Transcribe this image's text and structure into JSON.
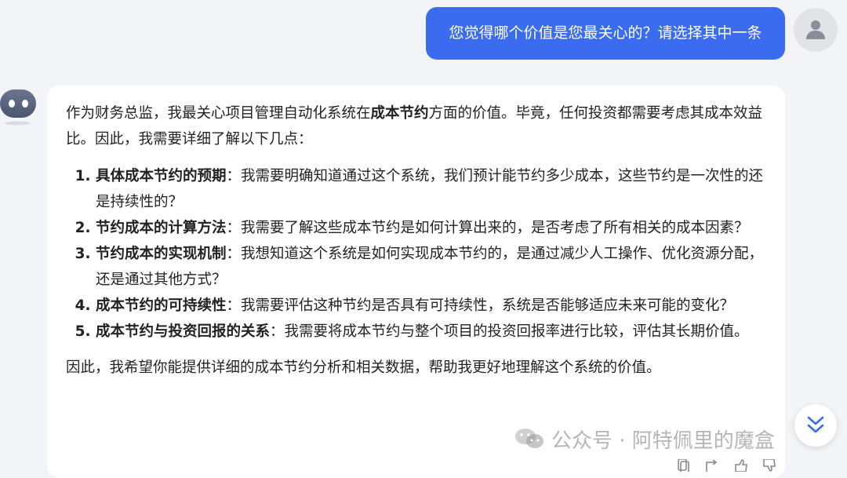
{
  "user_message": "您觉得哪个价值是您最关心的？请选择其中一条",
  "bot_reply": {
    "intro_pre": "作为财务总监，我最关心项目管理自动化系统在",
    "intro_bold": "成本节约",
    "intro_post": "方面的价值。毕竟，任何投资都需要考虑其成本效益比。因此，我需要详细了解以下几点：",
    "points": [
      {
        "title": "具体成本节约的预期",
        "text": "：我需要明确知道通过这个系统，我们预计能节约多少成本，这些节约是一次性的还是持续性的？"
      },
      {
        "title": "节约成本的计算方法",
        "text": "：我需要了解这些成本节约是如何计算出来的，是否考虑了所有相关的成本因素？"
      },
      {
        "title": "节约成本的实现机制",
        "text": "：我想知道这个系统是如何实现成本节约的，是通过减少人工操作、优化资源分配，还是通过其他方式？"
      },
      {
        "title": "成本节约的可持续性",
        "text": "：我需要评估这种节约是否具有可持续性，系统是否能够适应未来可能的变化？"
      },
      {
        "title": "成本节约与投资回报的关系",
        "text": "：我需要将成本节约与整个项目的投资回报率进行比较，评估其长期价值。"
      }
    ],
    "outro": "因此，我希望你能提供详细的成本节约分析和相关数据，帮助我更好地理解这个系统的价值。"
  },
  "watermark": "公众号 · 阿特佩里的魔盒",
  "icons": {
    "user_avatar": "user-icon",
    "bot_avatar": "bot-icon",
    "scroll": "double-chevron-down-icon",
    "watermark_logo": "wechat-icon"
  },
  "colors": {
    "user_bubble": "#3b6cf0",
    "bot_bubble": "#ffffff",
    "background": "#f3f4f8",
    "accent": "#3b6cf0"
  }
}
